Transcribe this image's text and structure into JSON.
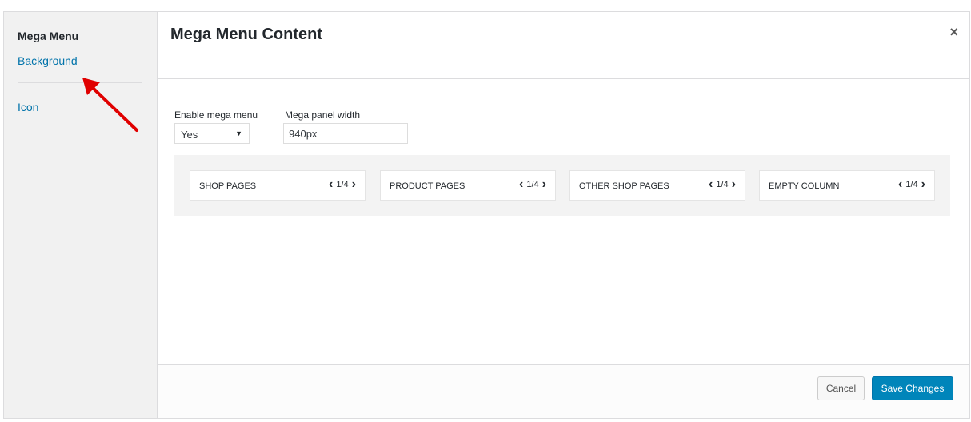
{
  "sidebar": {
    "title": "Mega Menu",
    "items": [
      {
        "label": "Background"
      },
      {
        "label": "Icon"
      }
    ]
  },
  "modal": {
    "title": "Mega Menu Content",
    "close_icon": "close-icon",
    "close_glyph": "×"
  },
  "form": {
    "enable_label": "Enable mega menu",
    "enable_value": "Yes",
    "width_label": "Mega panel width",
    "width_value": "940px"
  },
  "columns": [
    {
      "name": "SHOP PAGES",
      "width": "1/4"
    },
    {
      "name": "PRODUCT PAGES",
      "width": "1/4"
    },
    {
      "name": "OTHER SHOP PAGES",
      "width": "1/4"
    },
    {
      "name": "EMPTY COLUMN",
      "width": "1/4"
    }
  ],
  "footer": {
    "cancel_label": "Cancel",
    "save_label": "Save Changes"
  },
  "colors": {
    "accent": "#0085ba",
    "link": "#0073aa",
    "annotation_arrow": "#e00000"
  }
}
